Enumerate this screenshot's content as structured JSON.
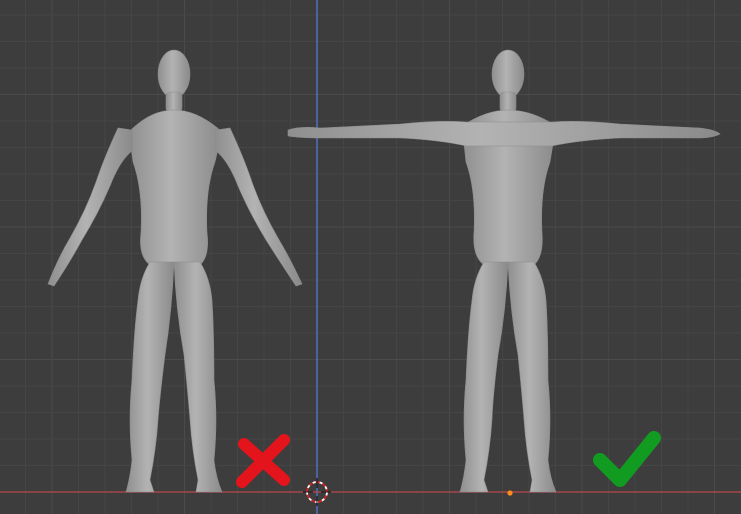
{
  "viewport": {
    "background": "#3d3d3d",
    "grid_minor_color": "#454545",
    "grid_major_color": "#4b4b4b",
    "axis_z_color": "#5478d6",
    "axis_x_color": "#b8474e",
    "mesh_color": "#a9a9a9",
    "origin_point_color": "#ff8c1a"
  },
  "figures": [
    {
      "name": "a-pose-model",
      "pose": "A-pose"
    },
    {
      "name": "t-pose-model",
      "pose": "T-pose"
    }
  ],
  "markers": {
    "wrong": {
      "icon": "red-x-icon",
      "color": "#e3141c"
    },
    "right": {
      "icon": "green-check-icon",
      "color": "#119b20"
    }
  },
  "icons": {
    "cursor": "3d-cursor-icon"
  }
}
